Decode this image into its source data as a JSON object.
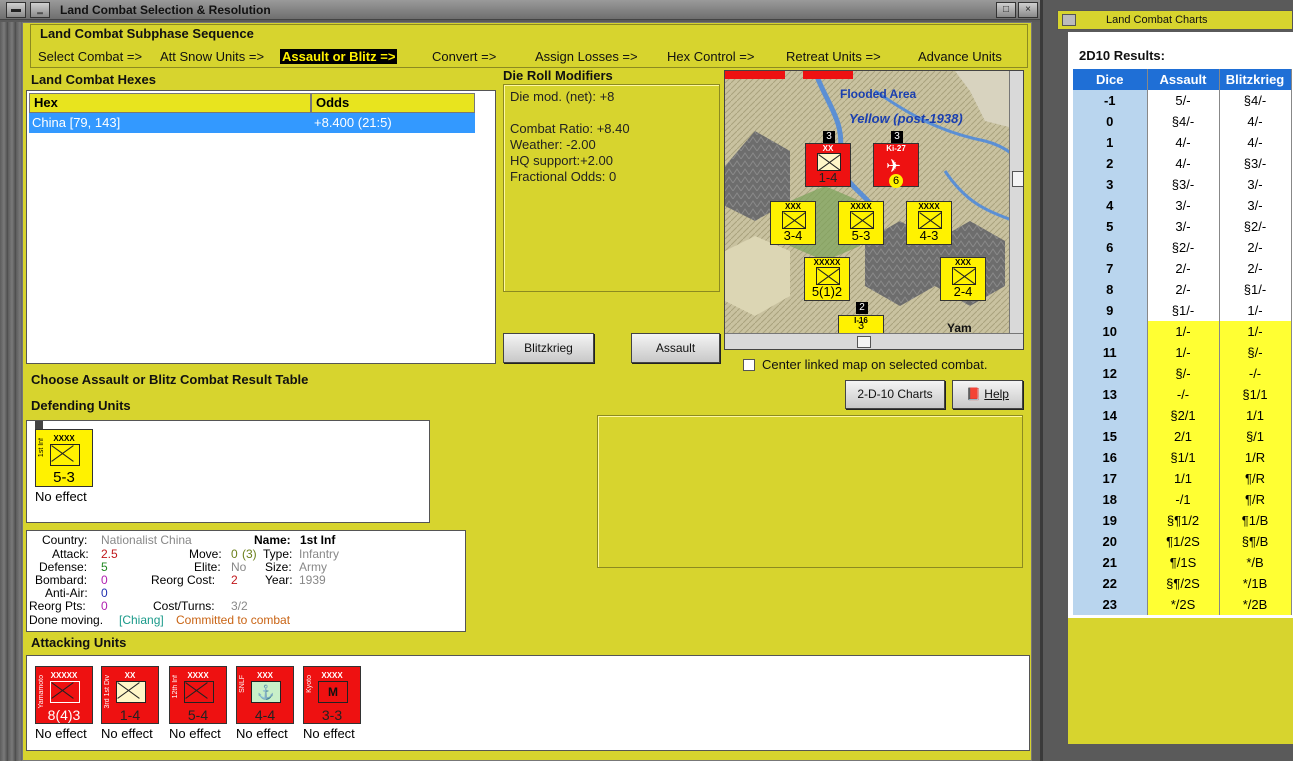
{
  "window": {
    "title": "Land Combat Selection & Resolution"
  },
  "subphase": {
    "title": "Land Combat Subphase Sequence",
    "steps": [
      "Select Combat =>",
      "Att Snow Units =>",
      "Assault or Blitz =>",
      "Convert =>",
      "Assign Losses =>",
      "Hex Control =>",
      "Retreat Units =>",
      "Advance Units"
    ]
  },
  "hexes": {
    "title": "Land Combat Hexes",
    "columns": [
      "Hex",
      "Odds"
    ],
    "rows": [
      {
        "hex": "China [79, 143]",
        "odds": "+8.400 (21:5)"
      }
    ]
  },
  "drm": {
    "title": "Die Roll Modifiers",
    "lines": [
      "Die mod. (net): +8",
      "",
      "Combat Ratio: +8.40",
      "Weather: -2.00",
      "HQ support:+2.00",
      "Fractional Odds: 0"
    ]
  },
  "buttons": {
    "blitzkrieg": "Blitzkrieg",
    "assault": "Assault",
    "charts": "2-D-10 Charts",
    "help": "Help"
  },
  "center_map": {
    "label": "Center linked map on selected combat.",
    "checked": false
  },
  "choose_label": "Choose Assault or Blitz Combat Result Table",
  "map": {
    "labels": [
      "Flooded Area",
      "Yellow (post-1938)",
      "Yam"
    ],
    "counters": [
      {
        "type": "XX",
        "value": "1-4",
        "color": "red"
      },
      {
        "type": "Ki-27",
        "value": "6",
        "color": "red"
      },
      {
        "type": "XXX",
        "value": "3-4",
        "color": "yellow"
      },
      {
        "type": "XXXX",
        "value": "5-3",
        "color": "yellow"
      },
      {
        "type": "XXXX",
        "value": "4-3",
        "color": "yellow"
      },
      {
        "type": "XXXXX",
        "value": "5(1)2",
        "color": "yellow"
      },
      {
        "type": "XXX",
        "value": "2-4",
        "color": "yellow"
      },
      {
        "type": "I-16",
        "value": "3",
        "color": "yellow"
      }
    ],
    "stack_badges": [
      "3",
      "3",
      "2"
    ]
  },
  "defending": {
    "title": "Defending Units",
    "units": [
      {
        "size": "XXXX",
        "side": "1st Inf",
        "value": "5-3",
        "status": "No effect"
      }
    ]
  },
  "info": {
    "country_label": "Country:",
    "country": "Nationalist China",
    "name_label": "Name:",
    "name": "1st Inf",
    "attack_label": "Attack:",
    "attack": "2.5",
    "move_label": "Move:",
    "move": "0",
    "move_paren": "(3)",
    "type_label": "Type:",
    "type": "Infantry",
    "defense_label": "Defense:",
    "defense": "5",
    "elite_label": "Elite:",
    "elite": "No",
    "size_label": "Size:",
    "size": "Army",
    "bombard_label": "Bombard:",
    "bombard": "0",
    "reorg_cost_label": "Reorg Cost:",
    "reorg_cost": "2",
    "year_label": "Year:",
    "year": "1939",
    "antiair_label": "Anti-Air:",
    "antiair": "0",
    "reorg_pts_label": "Reorg Pts:",
    "reorg_pts": "0",
    "cost_turns_label": "Cost/Turns:",
    "cost_turns": "3/2",
    "done_moving": "Done moving.",
    "hq": "[Chiang]",
    "committed": "Committed to combat"
  },
  "attacking": {
    "title": "Attacking Units",
    "units": [
      {
        "size": "XXXXX",
        "side": "Yamamoto",
        "value": "8(4)3",
        "status": "No effect"
      },
      {
        "size": "XX",
        "side": "3rd 1st Div",
        "value": "1-4",
        "status": "No effect"
      },
      {
        "size": "XXXX",
        "side": "12th Inf",
        "value": "5-4",
        "status": "No effect"
      },
      {
        "size": "XXX",
        "side": "SNLF",
        "value": "4-4",
        "status": "No effect"
      },
      {
        "size": "XXXX",
        "side": "Kyoto",
        "value": "3-3",
        "status": "No effect"
      }
    ]
  },
  "charts": {
    "window_title": "Land Combat Charts",
    "heading": "2D10 Results:",
    "columns": [
      "Dice",
      "Assault",
      "Blitzkrieg"
    ],
    "rows": [
      [
        "-1",
        "5/-",
        "§4/-"
      ],
      [
        "0",
        "§4/-",
        "4/-"
      ],
      [
        "1",
        "4/-",
        "4/-"
      ],
      [
        "2",
        "4/-",
        "§3/-"
      ],
      [
        "3",
        "§3/-",
        "3/-"
      ],
      [
        "4",
        "3/-",
        "3/-"
      ],
      [
        "5",
        "3/-",
        "§2/-"
      ],
      [
        "6",
        "§2/-",
        "2/-"
      ],
      [
        "7",
        "2/-",
        "2/-"
      ],
      [
        "8",
        "2/-",
        "§1/-"
      ],
      [
        "9",
        "§1/-",
        "1/-"
      ],
      [
        "10",
        "1/-",
        "1/-"
      ],
      [
        "11",
        "1/-",
        "§/-"
      ],
      [
        "12",
        "§/-",
        "-/-"
      ],
      [
        "13",
        "-/-",
        "§1/1"
      ],
      [
        "14",
        "§2/1",
        "1/1"
      ],
      [
        "15",
        "2/1",
        "§/1"
      ],
      [
        "16",
        "§1/1",
        "1/R"
      ],
      [
        "17",
        "1/1",
        "¶/R"
      ],
      [
        "18",
        "-/1",
        "¶/R"
      ],
      [
        "19",
        "§¶1/2",
        "¶1/B"
      ],
      [
        "20",
        "¶1/2S",
        "§¶/B"
      ],
      [
        "21",
        "¶/1S",
        "*/B"
      ],
      [
        "22",
        "§¶/2S",
        "*/1B"
      ],
      [
        "23",
        "*/2S",
        "*/2B"
      ]
    ],
    "colors": {
      "header": "#1f6fd6",
      "dice": "#b9d5ee",
      "highlight": "#ffff33",
      "plain": "#ffffff"
    }
  }
}
